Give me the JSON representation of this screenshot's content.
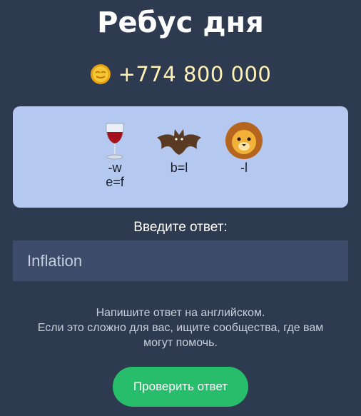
{
  "header": {
    "title": "Ребус дня"
  },
  "reward": {
    "amount": "+774 800 000",
    "icon": "coin-icon",
    "color": "#f3b51c"
  },
  "puzzle": {
    "clues": [
      {
        "icon": "wine-glass-icon",
        "caption_lines": [
          "-w",
          "e=f"
        ]
      },
      {
        "icon": "bat-icon",
        "caption_lines": [
          "b=l"
        ]
      },
      {
        "icon": "lion-icon",
        "caption_lines": [
          "-l"
        ]
      }
    ]
  },
  "answer_form": {
    "prompt": "Введите ответ:",
    "value": "Inflation",
    "hint_lines": [
      "Напишите ответ на английском.",
      "Если это сложно для вас, ищите сообщества, где вам",
      "могут помочь."
    ],
    "submit_label": "Проверить ответ"
  },
  "colors": {
    "background": "#2d3a4f",
    "puzzle_bg": "#b5c8ef",
    "button": "#27bd6a"
  }
}
